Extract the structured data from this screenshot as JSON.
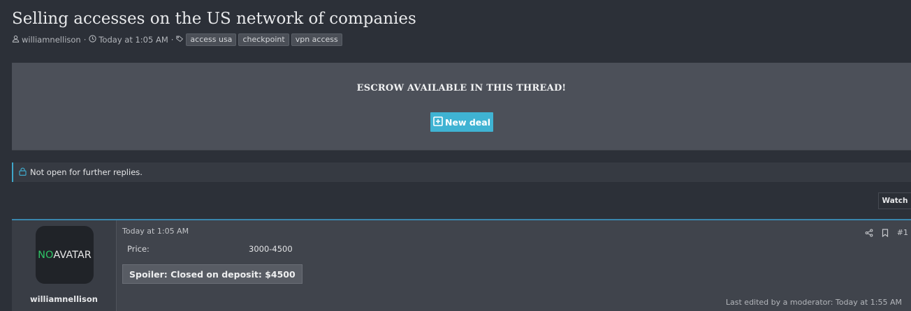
{
  "thread": {
    "title": "Selling accesses on the US network of companies",
    "author": "williamnellison",
    "date": "Today at 1:05 AM",
    "separator": "·",
    "tags": [
      "access usa",
      "checkpoint",
      "vpn access"
    ]
  },
  "escrow": {
    "title": "ESCROW AVAILABLE IN THIS THREAD!",
    "button_label": "New deal"
  },
  "notice": {
    "text": "Not open for further replies."
  },
  "toolbar": {
    "watch_label": "Watch"
  },
  "post": {
    "avatar_no": "NO",
    "avatar_text": "AVATAR",
    "username": "williamnellison",
    "date": "Today at 1:05 AM",
    "price_label": "Price:",
    "price_value": "3000-4500",
    "spoiler_label": "Spoiler: Closed on deposit: $4500",
    "post_number": "#1",
    "edited_text": "Last edited by a moderator: Today at 1:55 AM"
  },
  "colors": {
    "accent": "#3fb3d3",
    "background": "#2c3038",
    "avatar_no": "#2fc466"
  },
  "icons": [
    "user-icon",
    "clock-icon",
    "tag-icon",
    "plus-square-icon",
    "lock-icon",
    "share-icon",
    "bookmark-icon"
  ]
}
